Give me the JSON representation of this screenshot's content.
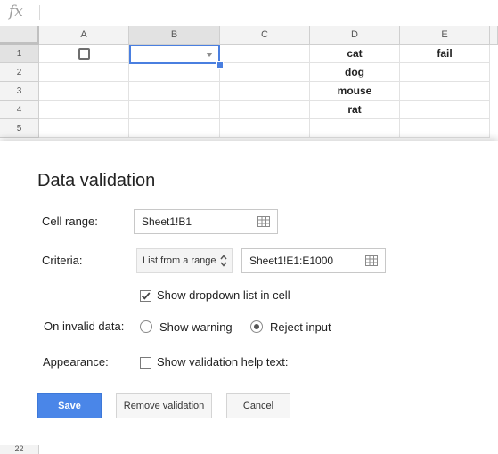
{
  "formula_bar": {
    "fx_symbol": "fx",
    "value": ""
  },
  "grid": {
    "columns": [
      "A",
      "B",
      "C",
      "D",
      "E"
    ],
    "rows": [
      "1",
      "2",
      "3",
      "4",
      "5"
    ],
    "cells": {
      "D1": "cat",
      "E1": "fail",
      "D2": "dog",
      "D3": "mouse",
      "D4": "rat"
    },
    "a1_checkbox_checked": false,
    "selected_cell": "B1",
    "bottom_row_label": "22"
  },
  "dialog": {
    "title": "Data validation",
    "cell_range_label": "Cell range:",
    "cell_range_value": "Sheet1!B1",
    "criteria_label": "Criteria:",
    "criteria_type": "List from a range",
    "criteria_range_value": "Sheet1!E1:E1000",
    "show_dropdown_label": "Show dropdown list in cell",
    "show_dropdown_checked": true,
    "invalid_label": "On invalid data:",
    "show_warning_label": "Show warning",
    "reject_input_label": "Reject input",
    "invalid_selected": "reject",
    "appearance_label": "Appearance:",
    "help_text_label": "Show validation help text:",
    "help_text_checked": false,
    "save_label": "Save",
    "remove_label": "Remove validation",
    "cancel_label": "Cancel"
  },
  "colors": {
    "accent": "#4a86e8",
    "selection": "#4a7fe0"
  },
  "icons": [
    "fx-icon",
    "checkbox-icon",
    "dropdown-arrow-icon",
    "grid-icon",
    "updown-arrows-icon",
    "check-icon",
    "radio-icon"
  ]
}
